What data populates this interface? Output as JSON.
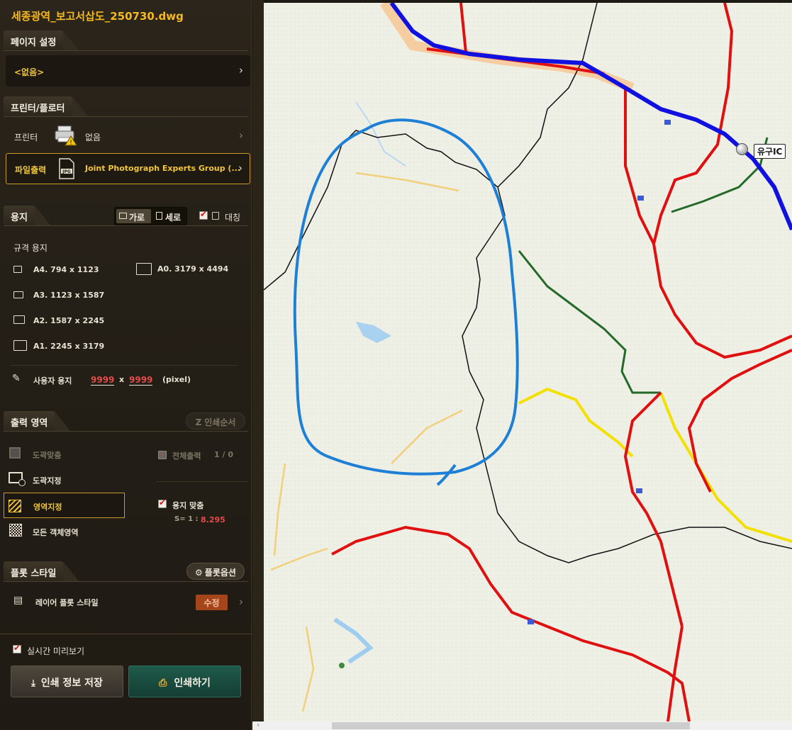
{
  "file": {
    "title": "세종광역_보고서삽도_250730.dwg"
  },
  "page_setup": {
    "section": "페이지 설정",
    "value": "<없음>"
  },
  "printer": {
    "section": "프린터/플로터",
    "printer_label": "프린터",
    "printer_value": "없음",
    "file_label": "파일출력",
    "file_value": "Joint Photograph Experts Group (..."
  },
  "paper": {
    "section": "용지",
    "landscape": "가로",
    "portrait": "세로",
    "mirror": "대칭",
    "std_label": "규격 용지",
    "sizes": [
      "A4. 794 x 1123",
      "A0. 3179 x 4494",
      "A3. 1123 x 1587",
      "A2. 1587 x 2245",
      "A1. 2245 x 3179"
    ],
    "custom_label": "사용자 용지",
    "custom_w": "9999",
    "x": "x",
    "custom_h": "9999",
    "unit": "(pixel)"
  },
  "output": {
    "section": "출력 영역",
    "print_order": "인쇄순서",
    "fit_frame": "도곽맞춤",
    "all_print": "전체출력",
    "count": "1 / 0",
    "set_frame": "도곽지정",
    "set_area": "영역지정",
    "paper_fit": "용지 맞춤",
    "scale_label": "S= 1 :",
    "scale_value": "8.295",
    "all_objects": "모든 객체영역"
  },
  "plot": {
    "section": "플롯 스타일",
    "options": "플롯옵션",
    "layer_style": "레이어 플롯 스타일",
    "edit": "수정"
  },
  "bottom": {
    "preview": "실시간 미리보기",
    "save": "인쇄 정보 저장",
    "print": "인쇄하기"
  },
  "map": {
    "ic_label": "유구IC"
  },
  "colors": {
    "accent": "#f5b820",
    "highway": "#1010e0",
    "road": "#e01010",
    "route": "#1e7fd6"
  }
}
